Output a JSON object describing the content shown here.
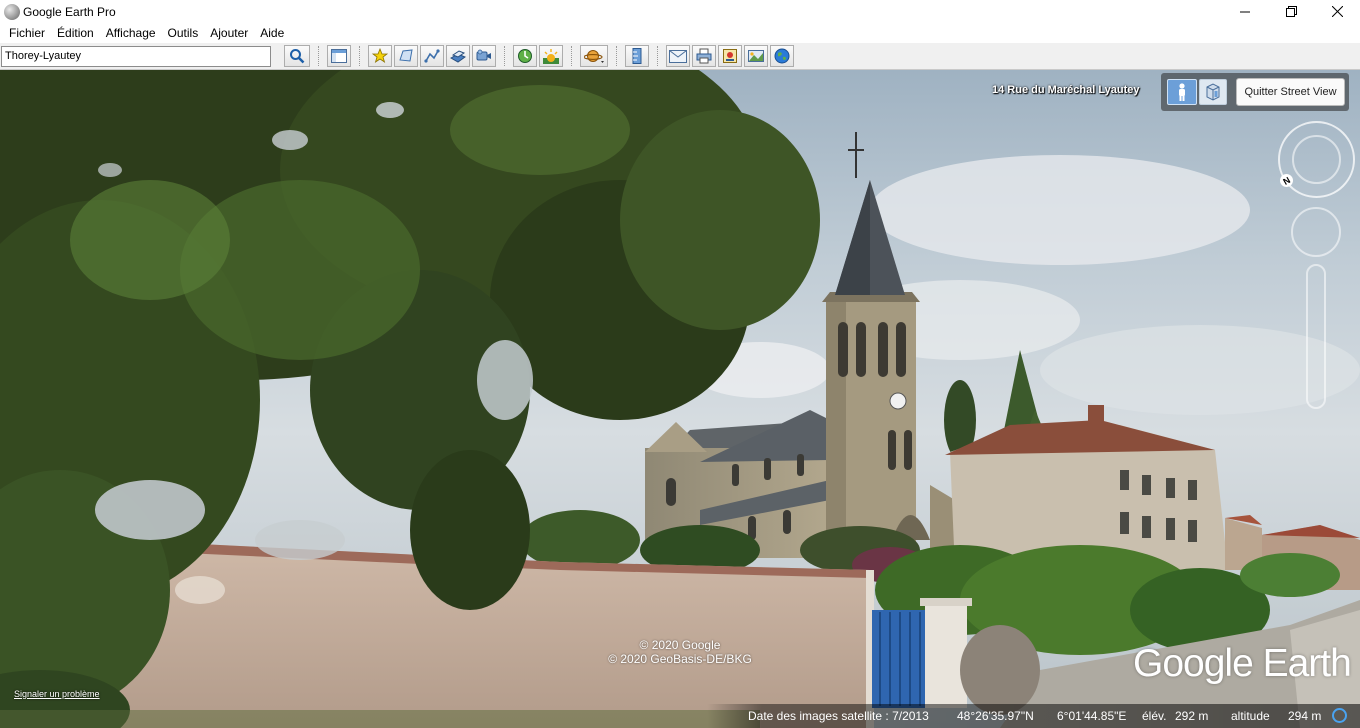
{
  "window": {
    "title": "Google Earth Pro",
    "minimize_icon": "minimize-icon",
    "maximize_icon": "maximize-icon",
    "close_icon": "close-icon"
  },
  "menu": {
    "items": [
      "Fichier",
      "Édition",
      "Affichage",
      "Outils",
      "Ajouter",
      "Aide"
    ]
  },
  "toolbar": {
    "search_value": "Thorey-Lyautey",
    "icons": [
      "search-icon",
      "sidebar-icon",
      "placemark-icon",
      "polygon-icon",
      "path-icon",
      "image-overlay-icon",
      "record-tour-icon",
      "historical-imagery-icon",
      "sunlight-icon",
      "planets-icon",
      "ruler-icon",
      "email-icon",
      "print-icon",
      "save-image-icon",
      "view-in-maps-icon",
      "earth-icon"
    ]
  },
  "streetview": {
    "address": "14 Rue du Maréchal Lyautey",
    "exit_label": "Quitter Street View",
    "compass_label": "N"
  },
  "overlay": {
    "copyright_line1": "© 2020 Google",
    "copyright_line2": "© 2020 GeoBasis-DE/BKG",
    "logo": "Google Earth",
    "report_link": "Signaler un problème"
  },
  "status": {
    "imagery_date": "Date des images satellite : 7/2013",
    "latitude": "48°26'35.97\"N",
    "longitude": "6°01'44.85\"E",
    "elevation_label": "élév.",
    "elevation_value": "292 m",
    "altitude_label": "altitude",
    "altitude_value": "294 m"
  },
  "colors": {
    "accent": "#6c9fd8",
    "toolbar_bg": "#f0f0f0",
    "stream_indicator": "#4aa3f0"
  }
}
